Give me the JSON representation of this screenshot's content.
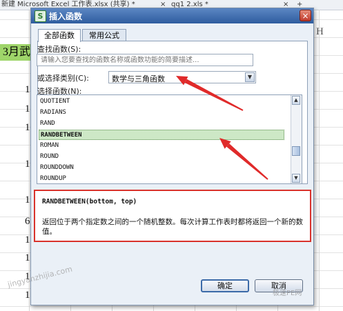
{
  "background": {
    "tab_title_1": "新建 Microsoft Excel 工作表.xlsx (共享) *",
    "tab_close_1": "×",
    "tab_title_2": "qq1 2.xls *",
    "tab_close_2": "×",
    "tab_add": "+",
    "column_header_h": "H",
    "cell_a3": "3月武",
    "row_digits": [
      "1",
      "1",
      "1",
      "1",
      "1",
      "6",
      "1",
      "1",
      "1",
      "1"
    ]
  },
  "dialog": {
    "title": "插入函数",
    "app_icon": "S",
    "close_label": "×",
    "tabs": [
      {
        "label": "全部函数",
        "active": true
      },
      {
        "label": "常用公式",
        "active": false
      }
    ],
    "search_label": "查找函数(S):",
    "search_placeholder": "请输入您要查找的函数名称或函数功能的简要描述...",
    "category_label": "或选择类别(C):",
    "category_value": "数学与三角函数",
    "function_list_label": "选择函数(N):",
    "functions": [
      "QUOTIENT",
      "RADIANS",
      "RAND",
      "RANDBETWEEN",
      "ROMAN",
      "ROUND",
      "ROUNDDOWN",
      "ROUNDUP"
    ],
    "selected_function": "RANDBETWEEN",
    "description": {
      "signature": "RANDBETWEEN(bottom, top)",
      "text": "返回位于两个指定数之间的一个随机整数。每次计算工作表时都将返回一个新的数值。"
    },
    "buttons": {
      "ok": "确定",
      "cancel": "取消"
    }
  },
  "watermark": {
    "left": "jingyanzhijia.com",
    "right": "极速PE网"
  },
  "annotation_color": "#e02a2a",
  "accent_colors": {
    "selected_row": "#cde8c6",
    "titlebar": "#2f5d9f",
    "highlight_box": "#d9322b"
  }
}
